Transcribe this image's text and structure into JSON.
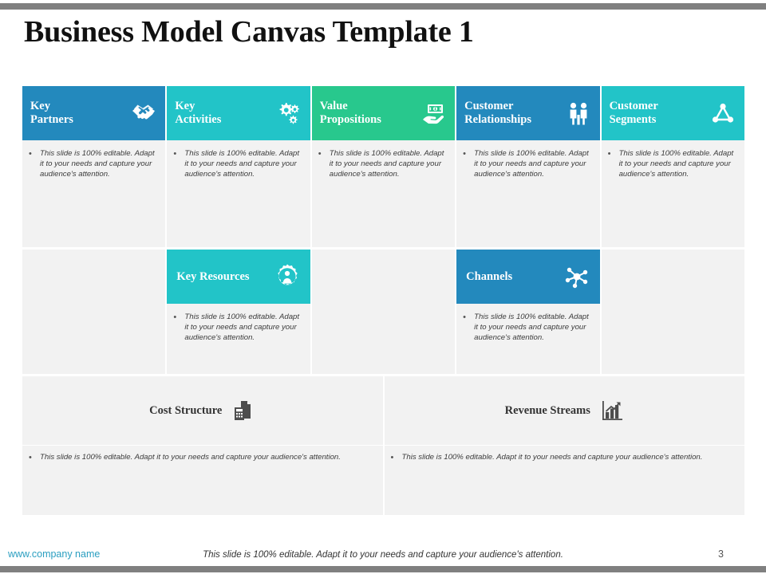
{
  "slide": {
    "title": "Business Model Canvas Template 1",
    "page_number": "3",
    "body_text": "This slide is 100% editable. Adapt it to your needs and capture your audience's attention.",
    "bullet_glyph": "•"
  },
  "colors": {
    "blue": "#2389bd",
    "teal": "#22c4c8",
    "green": "#28c88d",
    "cell_bg": "#f2f2f2",
    "dark_icon": "#4d4d4d",
    "edge_bar": "#808080",
    "link": "#2a9ec0"
  },
  "top_row": [
    {
      "title": "Key\nPartners",
      "color": "#2389bd",
      "icon": "handshake-icon"
    },
    {
      "title": "Key\nActivities",
      "color": "#22c4c8",
      "icon": "gears-icon"
    },
    {
      "title": "Value\nPropositions",
      "color": "#28c88d",
      "icon": "money-hand-icon"
    },
    {
      "title": "Customer\nRelationships",
      "color": "#2389bd",
      "icon": "two-people-icon"
    },
    {
      "title": "Customer\nSegments",
      "color": "#22c4c8",
      "icon": "network-group-icon"
    }
  ],
  "mid_row": [
    {
      "title": "Key Resources",
      "color": "#22c4c8",
      "icon": "person-gear-icon",
      "column": 2
    },
    {
      "title": "Channels",
      "color": "#2389bd",
      "icon": "hub-spoke-icon",
      "column": 4
    }
  ],
  "bottom_row": [
    {
      "title": "Cost Structure",
      "icon": "calculator-document-icon"
    },
    {
      "title": "Revenue Streams",
      "icon": "bar-chart-arrow-icon"
    }
  ],
  "footer": {
    "website": "www.company name",
    "note": "This slide is 100% editable. Adapt it to your needs and capture your audience's attention.",
    "page": "3"
  }
}
